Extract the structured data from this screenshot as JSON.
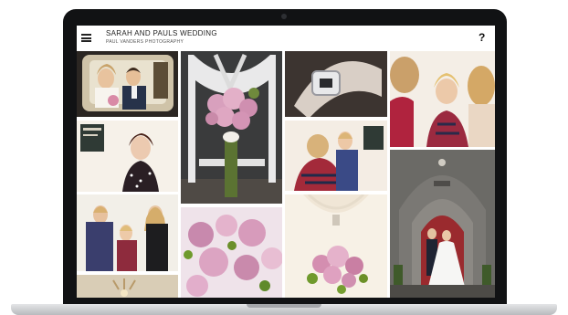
{
  "app": {
    "title": "SARAH AND PAULS WEDDING",
    "subtitle": "PAUL VANDERS PHOTOGRAPHY",
    "menu_icon": "hamburger-menu-icon",
    "help_label": "?"
  },
  "colors": {
    "bezel": "#111214",
    "screen_background": "#ffffff",
    "title_text": "#222222"
  },
  "gallery": {
    "photos": [
      {
        "name": "photo-couple-in-car",
        "description": "Bride and groom in wedding car"
      },
      {
        "name": "photo-bouquet-on-chair",
        "description": "Pink rose bouquet on white chair"
      },
      {
        "name": "photo-shoe-buckle",
        "description": "Silver shoe buckle close-up"
      },
      {
        "name": "photo-bride-getting-ready",
        "description": "Bridesmaids getting ready"
      },
      {
        "name": "photo-woman-polka-dress",
        "description": "Woman in polka dot dress"
      },
      {
        "name": "photo-hair-styling",
        "description": "Bride having hair styled"
      },
      {
        "name": "photo-makeup-session",
        "description": "Makeup session"
      },
      {
        "name": "photo-church-couple",
        "description": "Couple at church door"
      },
      {
        "name": "photo-roses-closeup",
        "description": "Pink roses close-up"
      },
      {
        "name": "photo-bride-holding-bouquet",
        "description": "Bride holding bouquet"
      },
      {
        "name": "photo-chandelier",
        "description": "Chandelier"
      }
    ]
  }
}
